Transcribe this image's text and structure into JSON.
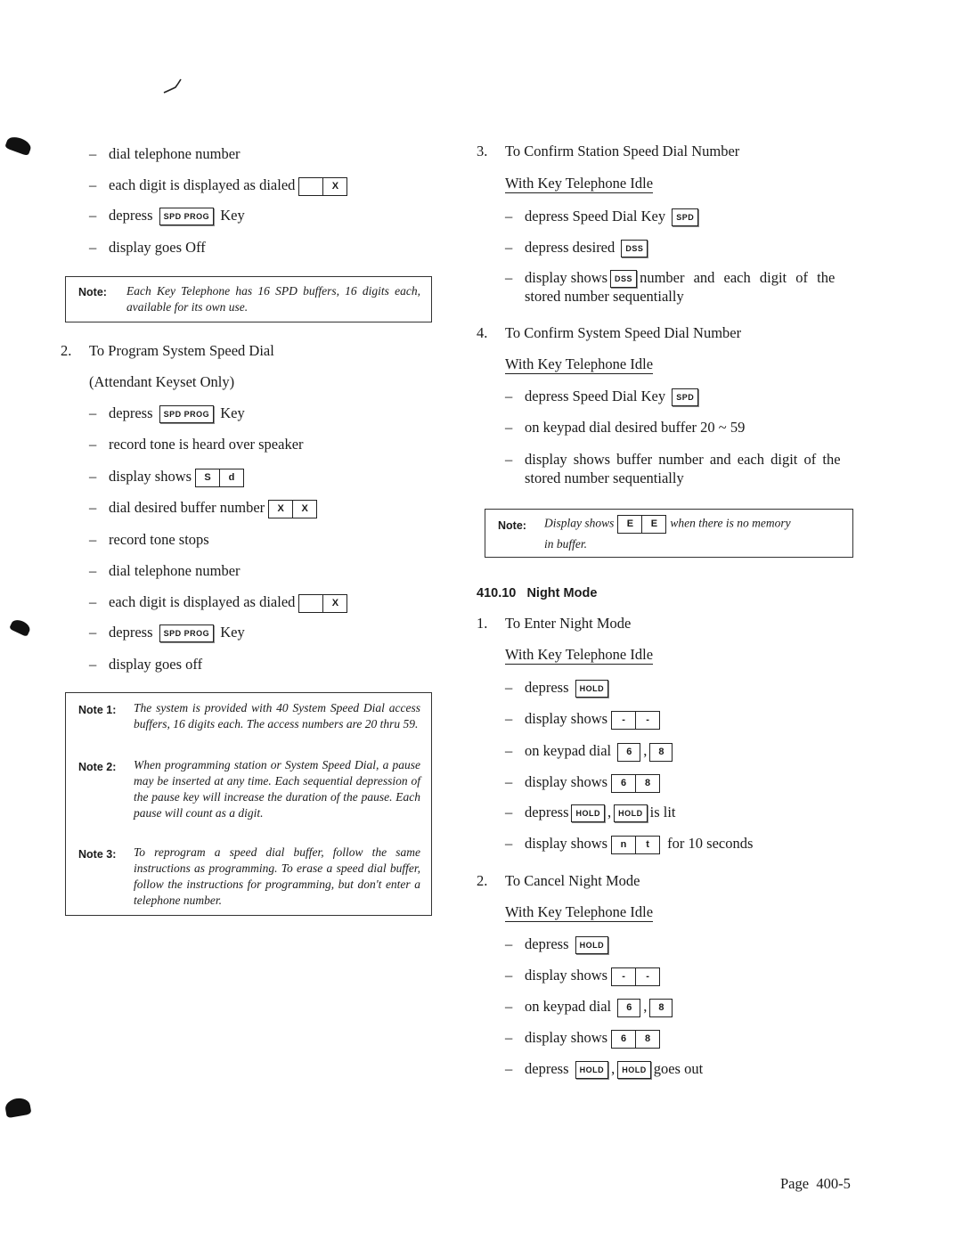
{
  "left": {
    "top_steps": [
      "dial telephone number",
      "each digit is displayed as dialed",
      "depress",
      "display goes Off"
    ],
    "key_suffix": "Key",
    "spd_prog": "SPD PROG",
    "digit_display": [
      "",
      "X"
    ],
    "note1": {
      "label": "Note:",
      "text": "Each Key Telephone has 16 SPD buffers, 16 digits each, available for its own use."
    },
    "section2": {
      "number": "2.",
      "title": "To Program System Speed Dial",
      "subtitle": "(Attendant Keyset Only)",
      "steps": [
        "depress",
        "record tone is heard over speaker",
        "display shows",
        "dial desired buffer number",
        "record tone stops",
        "dial telephone number",
        "each digit is displayed as dialed",
        "depress",
        "display goes off"
      ],
      "sd_display": [
        "S",
        "d"
      ],
      "xx_display": [
        "X",
        "X"
      ]
    },
    "notes": [
      {
        "label": "Note 1:",
        "text": "The system is provided with 40 System Speed Dial access buffers, 16 digits each. The access numbers are 20 thru 59."
      },
      {
        "label": "Note 2:",
        "text": "When programming station or System Speed Dial, a pause may be inserted at any time. Each sequential depression of the pause key will increase the duration of the pause. Each pause will count as a digit."
      },
      {
        "label": "Note 3:",
        "text": "To reprogram a speed dial buffer, follow the same instructions as programming. To erase a speed dial buffer, follow the instructions for programming, but don't enter a telephone number."
      }
    ]
  },
  "right": {
    "section3": {
      "number": "3.",
      "title": "To Confirm Station Speed Dial Number",
      "condition": "With Key Telephone Idle",
      "steps": [
        "depress Speed Dial Key",
        "depress desired",
        "display shows",
        "number and each digit of the",
        "stored number sequentially"
      ],
      "spd": "SPD",
      "dss": "DSS"
    },
    "section4": {
      "number": "4.",
      "title": "To Confirm System Speed Dial Number",
      "condition": "With Key Telephone Idle",
      "steps": [
        "depress Speed Dial Key",
        "on keypad dial desired buffer 20 ~ 59",
        "display shows buffer number and each digit of the",
        "stored number sequentially"
      ],
      "spd": "SPD"
    },
    "note": {
      "label": "Note:",
      "pre": "Display shows",
      "display": [
        "E",
        "E"
      ],
      "post": "when there is no memory",
      "line2": "in buffer."
    },
    "night_mode": {
      "section_number": "410.10",
      "section_title": "Night Mode",
      "hold": "HOLD",
      "enter": {
        "number": "1.",
        "title": "To Enter Night Mode",
        "condition": "With Key Telephone Idle",
        "steps": [
          "depress",
          "display shows",
          "on keypad dial",
          "display shows",
          "depress",
          "is lit",
          "display shows",
          "for 10 seconds"
        ],
        "dash_display": [
          "-",
          "-"
        ],
        "keys": [
          "6",
          "8"
        ],
        "display_68": [
          "6",
          "8"
        ],
        "nt_display": [
          "n",
          "t"
        ]
      },
      "cancel": {
        "number": "2.",
        "title": "To Cancel Night Mode",
        "condition": "With Key Telephone Idle",
        "steps": [
          "depress",
          "display shows",
          "on keypad dial",
          "display shows",
          "depress",
          "goes out"
        ],
        "dash_display": [
          "-",
          "-"
        ],
        "keys": [
          "6",
          "8"
        ],
        "display_68": [
          "6",
          "8"
        ]
      }
    }
  },
  "footer": {
    "page": "Page  400-5"
  }
}
